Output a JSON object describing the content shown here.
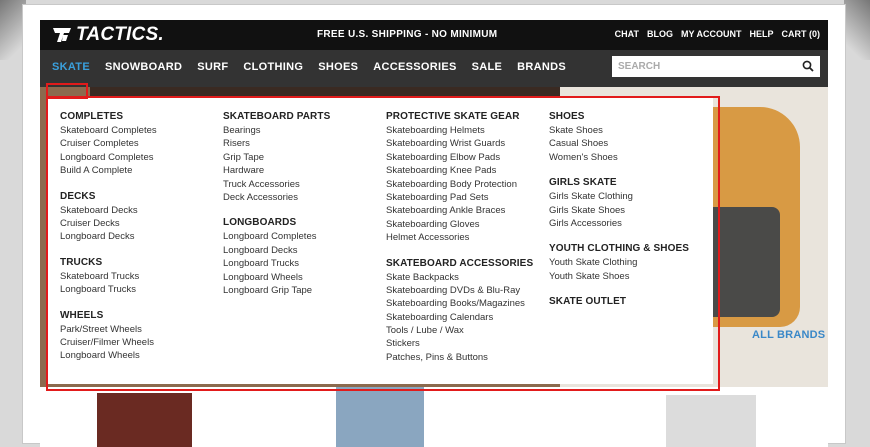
{
  "site": {
    "logo_text": "TACTICS."
  },
  "topbar": {
    "shipping": "FREE U.S. SHIPPING - NO MINIMUM",
    "links": [
      "CHAT",
      "BLOG",
      "MY ACCOUNT",
      "HELP",
      "CART (0)"
    ]
  },
  "nav": {
    "items": [
      "SKATE",
      "SNOWBOARD",
      "SURF",
      "CLOTHING",
      "SHOES",
      "ACCESSORIES",
      "SALE",
      "BRANDS"
    ],
    "search_placeholder": "SEARCH"
  },
  "mega": {
    "col1": {
      "sections": [
        {
          "title": "COMPLETES",
          "links": [
            "Skateboard Completes",
            "Cruiser Completes",
            "Longboard Completes",
            "Build A Complete"
          ]
        },
        {
          "title": "DECKS",
          "links": [
            "Skateboard Decks",
            "Cruiser Decks",
            "Longboard Decks"
          ]
        },
        {
          "title": "TRUCKS",
          "links": [
            "Skateboard Trucks",
            "Longboard Trucks"
          ]
        },
        {
          "title": "WHEELS",
          "links": [
            "Park/Street Wheels",
            "Cruiser/Filmer Wheels",
            "Longboard Wheels"
          ]
        }
      ]
    },
    "col2": {
      "sections": [
        {
          "title": "SKATEBOARD PARTS",
          "links": [
            "Bearings",
            "Risers",
            "Grip Tape",
            "Hardware",
            "Truck Accessories",
            "Deck Accessories"
          ]
        },
        {
          "title": "LONGBOARDS",
          "links": [
            "Longboard Completes",
            "Longboard Decks",
            "Longboard Trucks",
            "Longboard Wheels",
            "Longboard Grip Tape"
          ]
        }
      ]
    },
    "col3": {
      "sections": [
        {
          "title": "PROTECTIVE SKATE GEAR",
          "links": [
            "Skateboarding Helmets",
            "Skateboarding Wrist Guards",
            "Skateboarding Elbow Pads",
            "Skateboarding Knee Pads",
            "Skateboarding Body Protection",
            "Skateboarding Pad Sets",
            "Skateboarding Ankle Braces",
            "Skateboarding Gloves",
            "Helmet Accessories"
          ]
        },
        {
          "title": "SKATEBOARD ACCESSORIES",
          "links": [
            "Skate Backpacks",
            "Skateboarding DVDs & Blu-Ray",
            "Skateboarding Books/Magazines",
            "Skateboarding Calendars",
            "Tools / Lube / Wax",
            "Stickers",
            "Patches, Pins & Buttons"
          ]
        }
      ]
    },
    "col4": {
      "sections": [
        {
          "title": "SHOES",
          "links": [
            "Skate Shoes",
            "Casual Shoes",
            "Women's Shoes"
          ]
        },
        {
          "title": "GIRLS SKATE",
          "links": [
            "Girls Skate Clothing",
            "Girls Skate Shoes",
            "Girls Accessories"
          ]
        },
        {
          "title": "YOUTH CLOTHING & SHOES",
          "links": [
            "Youth Skate Clothing",
            "Youth Skate Shoes"
          ]
        },
        {
          "title": "SKATE OUTLET",
          "links": []
        }
      ]
    }
  },
  "all_brands": "ALL BRANDS",
  "colors": {
    "nav_active": "#3aa0dd",
    "highlight": "#e21b1b",
    "link_blue": "#3a88c8"
  }
}
